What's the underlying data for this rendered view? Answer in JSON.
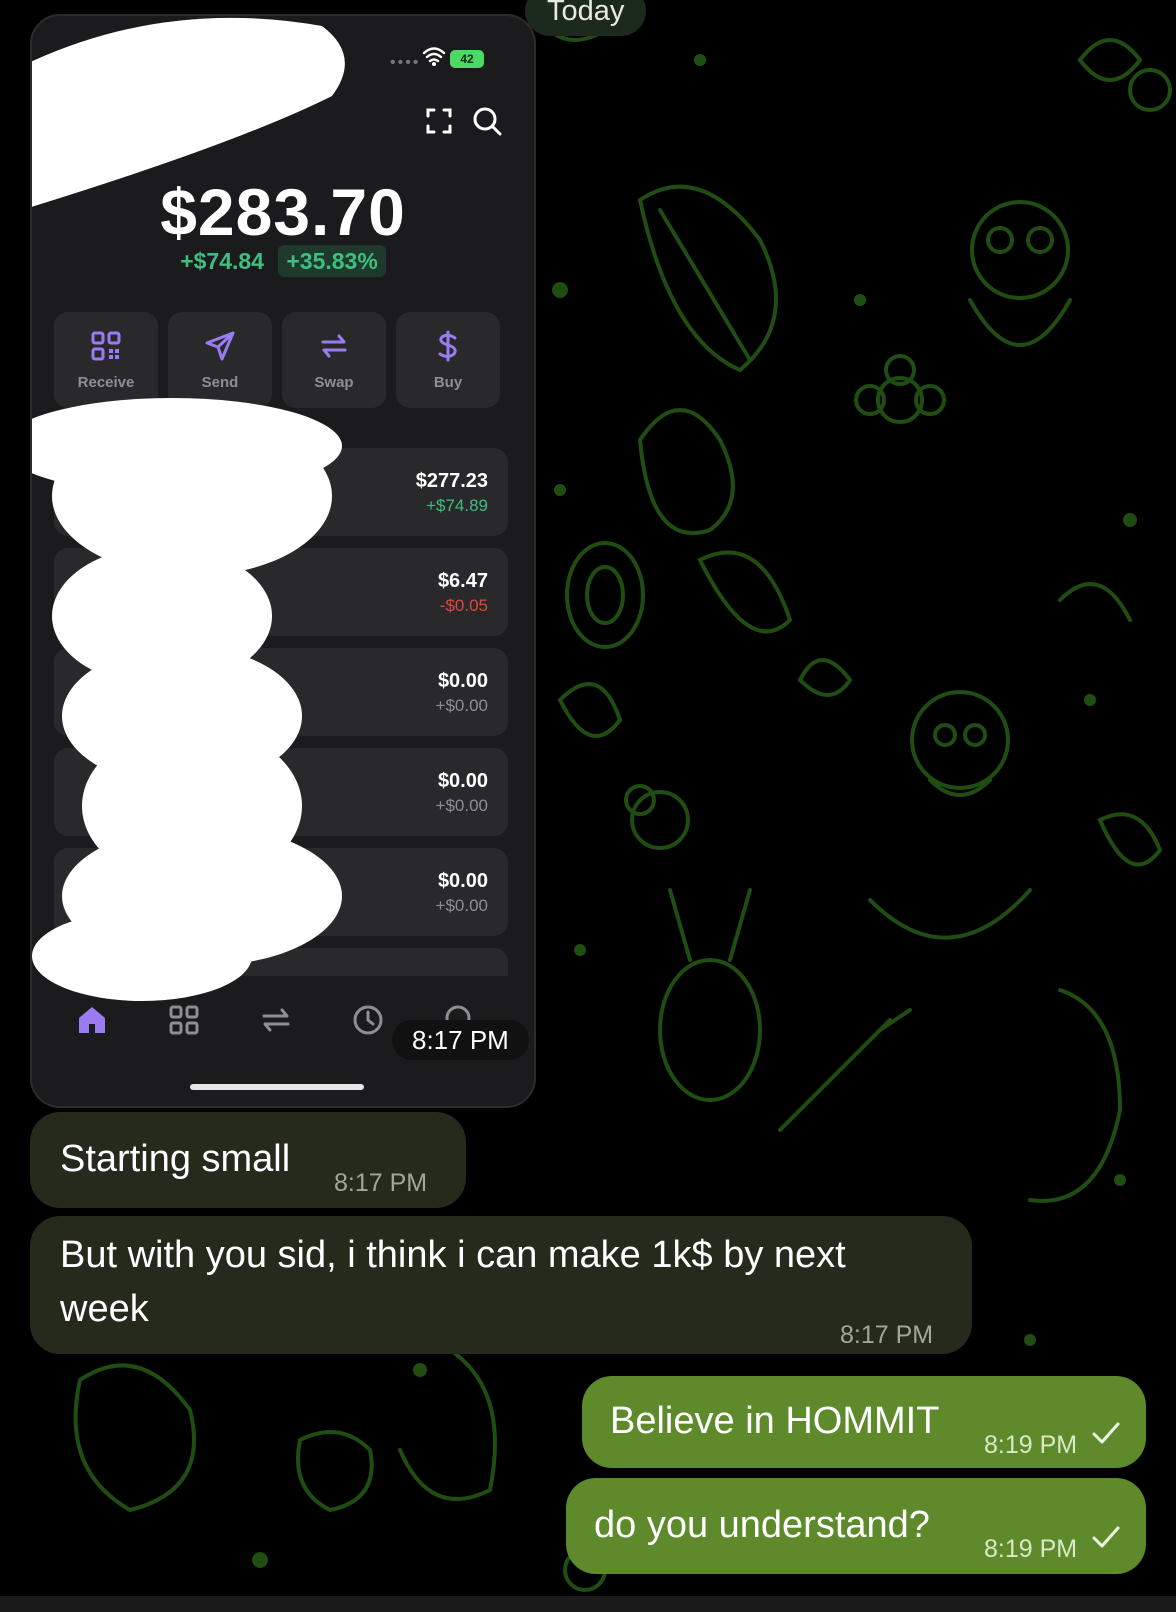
{
  "chat": {
    "date_label": "Today",
    "messages": [
      {
        "text": "Starting small",
        "time": "8:17 PM",
        "direction": "incoming"
      },
      {
        "text": "But with you sid, i think i can make 1k$ by next week",
        "time": "8:17 PM",
        "direction": "incoming"
      },
      {
        "text": "Believe in HOMMIT",
        "time": "8:19 PM",
        "direction": "outgoing",
        "status": "sent-check-icon"
      },
      {
        "text": "do you understand?",
        "time": "8:19 PM",
        "direction": "outgoing",
        "status": "sent-check-icon"
      }
    ]
  },
  "screenshot_message": {
    "time": "8:17 PM",
    "wallet": {
      "battery": "42",
      "balance": "$283.70",
      "change_abs": "+$74.84",
      "change_pct": "+35.83%",
      "actions": [
        {
          "label": "Receive",
          "icon": "qr-code-icon"
        },
        {
          "label": "Send",
          "icon": "paper-plane-icon"
        },
        {
          "label": "Swap",
          "icon": "swap-arrows-icon"
        },
        {
          "label": "Buy",
          "icon": "dollar-icon"
        }
      ],
      "assets": [
        {
          "value": "$277.23",
          "change": "+$74.89"
        },
        {
          "value": "$6.47",
          "change": "-$0.05"
        },
        {
          "value": "$0.00",
          "change": "+$0.00"
        },
        {
          "value": "$0.00",
          "change": "+$0.00"
        },
        {
          "value": "$0.00",
          "change": "+$0.00"
        }
      ],
      "tabs": [
        "home-icon",
        "grid-icon",
        "swap-icon",
        "history-clock-icon",
        "search-icon"
      ]
    }
  },
  "colors": {
    "background": "#000000",
    "doodle": "#1f4d12",
    "incoming_bubble": "#262a1d",
    "outgoing_bubble": "#5e8a2c",
    "positive": "#3fbf7f",
    "negative": "#e0483b",
    "accent_purple": "#9b7bf2"
  }
}
